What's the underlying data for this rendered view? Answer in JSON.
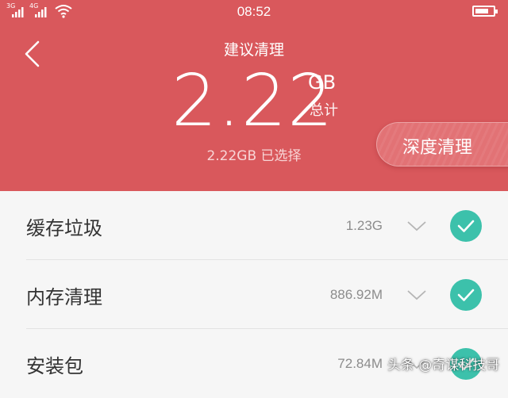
{
  "status_bar": {
    "sim1": "3G",
    "sim2": "4G",
    "time": "08:52"
  },
  "header": {
    "title": "建议清理",
    "total_value": "2.22",
    "total_unit": "GB",
    "total_caption": "总计",
    "selected_text": "2.22GB 已选择",
    "deep_clean_label": "深度清理"
  },
  "items": [
    {
      "name": "缓存垃圾",
      "size": "1.23G",
      "checked": true
    },
    {
      "name": "内存清理",
      "size": "886.92M",
      "checked": true
    },
    {
      "name": "安装包",
      "size": "72.84M",
      "checked": true
    }
  ],
  "watermark": "头条 @奇谋科技哥",
  "colors": {
    "header_bg": "#d9585c",
    "check": "#3cc1ab",
    "list_bg": "#f6f6f6"
  }
}
